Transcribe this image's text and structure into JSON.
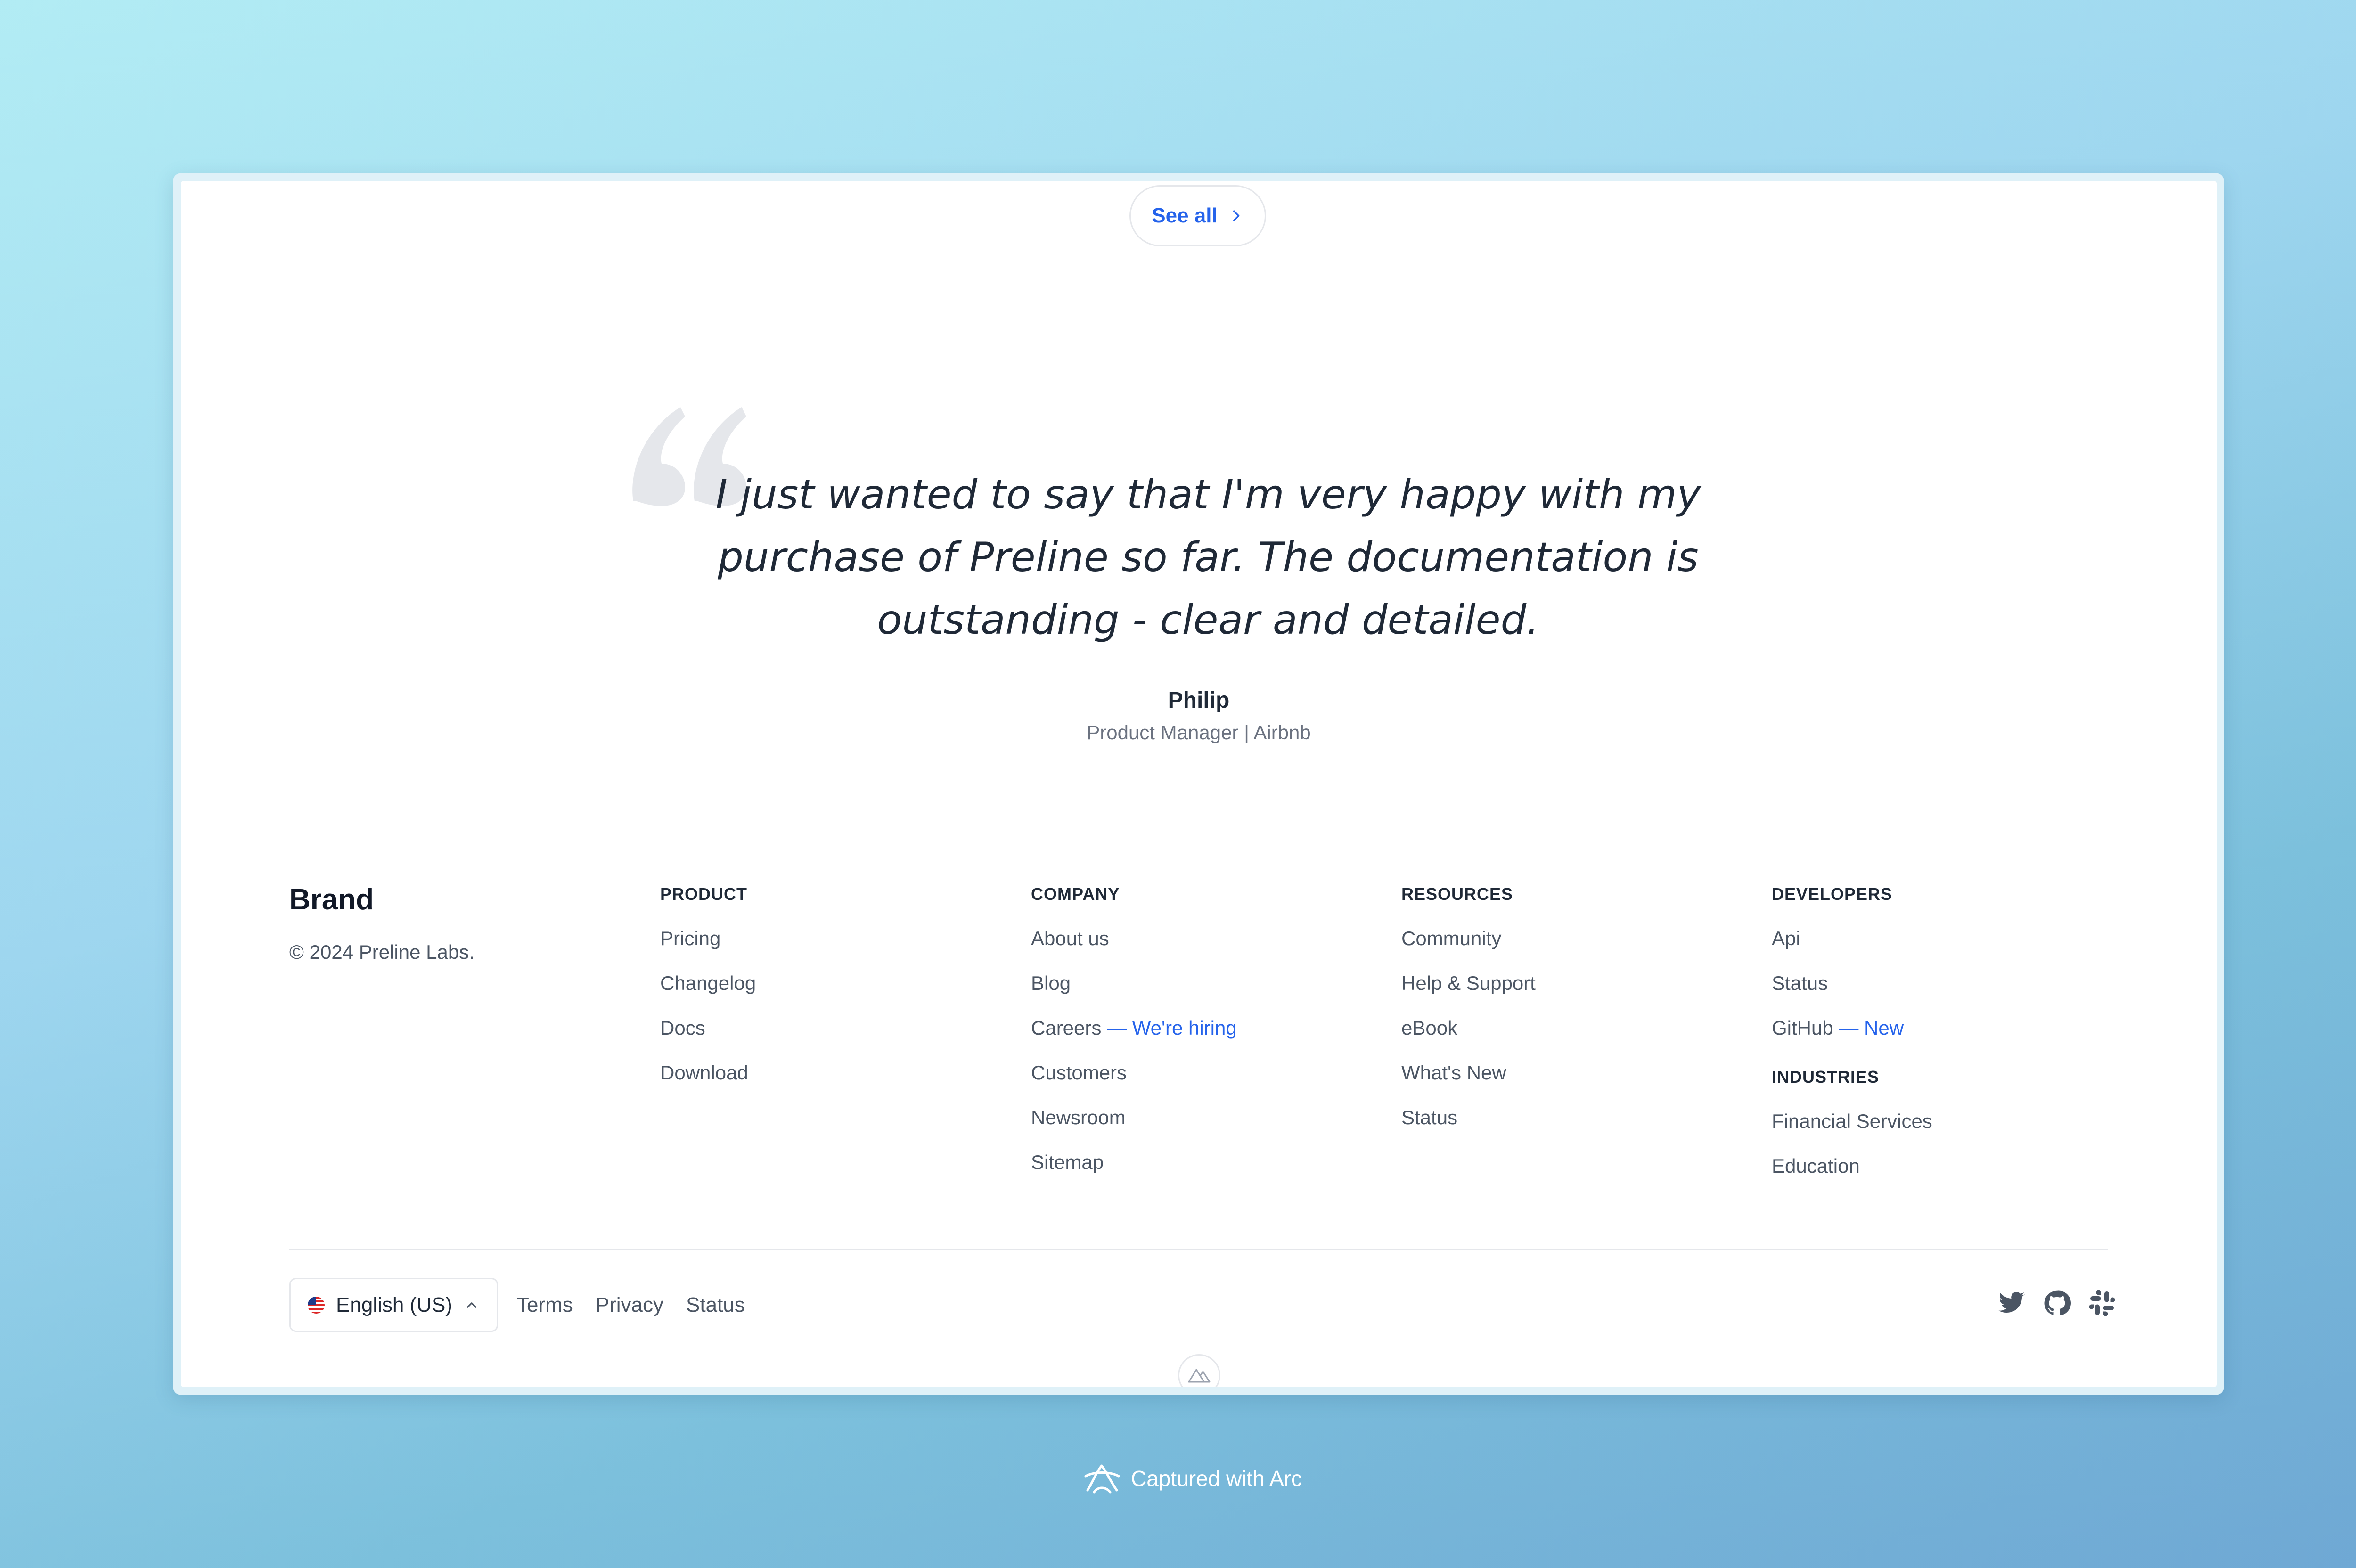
{
  "see_all": {
    "label": "See all"
  },
  "testimonial": {
    "quote": "I just wanted to say that I'm very happy with my purchase of Preline so far. The documentation is outstanding - clear and detailed.",
    "author": "Philip",
    "role": "Product Manager | Airbnb"
  },
  "footer": {
    "brand": "Brand",
    "copyright": "© 2024 Preline Labs.",
    "columns": [
      {
        "heading": "PRODUCT",
        "links": [
          "Pricing",
          "Changelog",
          "Docs",
          "Download"
        ]
      },
      {
        "heading": "COMPANY",
        "links": [
          "About us",
          "Blog",
          "Careers",
          "Customers",
          "Newsroom",
          "Sitemap"
        ],
        "careers_badge": "— We're hiring"
      },
      {
        "heading": "RESOURCES",
        "links": [
          "Community",
          "Help & Support",
          "eBook",
          "What's New",
          "Status"
        ]
      },
      {
        "heading": "DEVELOPERS",
        "links": [
          "Api",
          "Status",
          "GitHub"
        ],
        "github_badge": "— New"
      },
      {
        "heading": "INDUSTRIES",
        "links": [
          "Financial Services",
          "Education"
        ]
      }
    ],
    "language": "English (US)",
    "bottom_links": [
      "Terms",
      "Privacy",
      "Status"
    ],
    "social_icons": [
      "twitter-icon",
      "github-icon",
      "slack-icon"
    ]
  },
  "arc_caption": "Captured with Arc",
  "colors": {
    "accent": "#2563eb",
    "text_primary": "#1f2937",
    "text_secondary": "#4b5563",
    "border": "#e5e7eb"
  }
}
